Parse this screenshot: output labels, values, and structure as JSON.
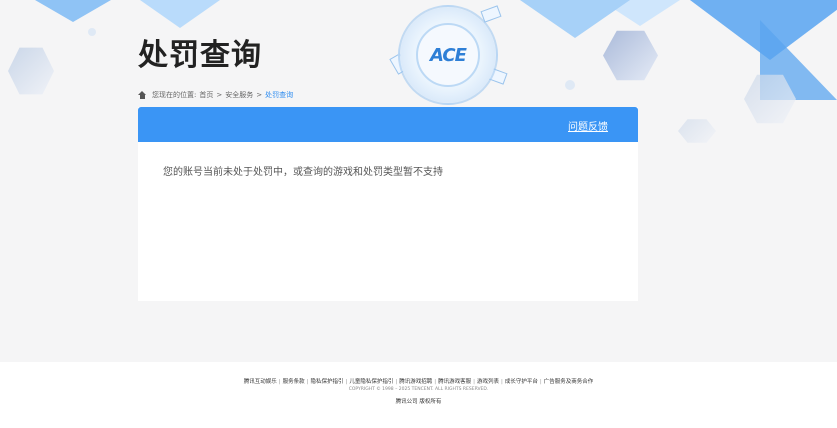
{
  "header": {
    "title": "处罚查询",
    "logo_text": "ACE"
  },
  "breadcrumb": {
    "prefix": "您现在的位置:",
    "home": "首页",
    "sep1": ">",
    "section": "安全服务",
    "sep2": ">",
    "current": "处罚查询"
  },
  "panel": {
    "feedback_label": "问题反馈",
    "message": "您的账号当前未处于处罚中，或查询的游戏和处罚类型暂不支持"
  },
  "footer": {
    "links": [
      "腾讯互动娱乐",
      "服务条款",
      "隐私保护指引",
      "儿童隐私保护指引",
      "腾讯游戏招聘",
      "腾讯游戏客服",
      "游戏列表",
      "成长守护平台",
      "广告服务及商务合作"
    ],
    "separator": "|",
    "copyright": "COPYRIGHT © 1998 – 2025 TENCENT. ALL RIGHTS RESERVED.",
    "company": "腾讯公司 版权所有"
  },
  "colors": {
    "accent": "#3a95f5",
    "background": "#f5f5f6"
  }
}
